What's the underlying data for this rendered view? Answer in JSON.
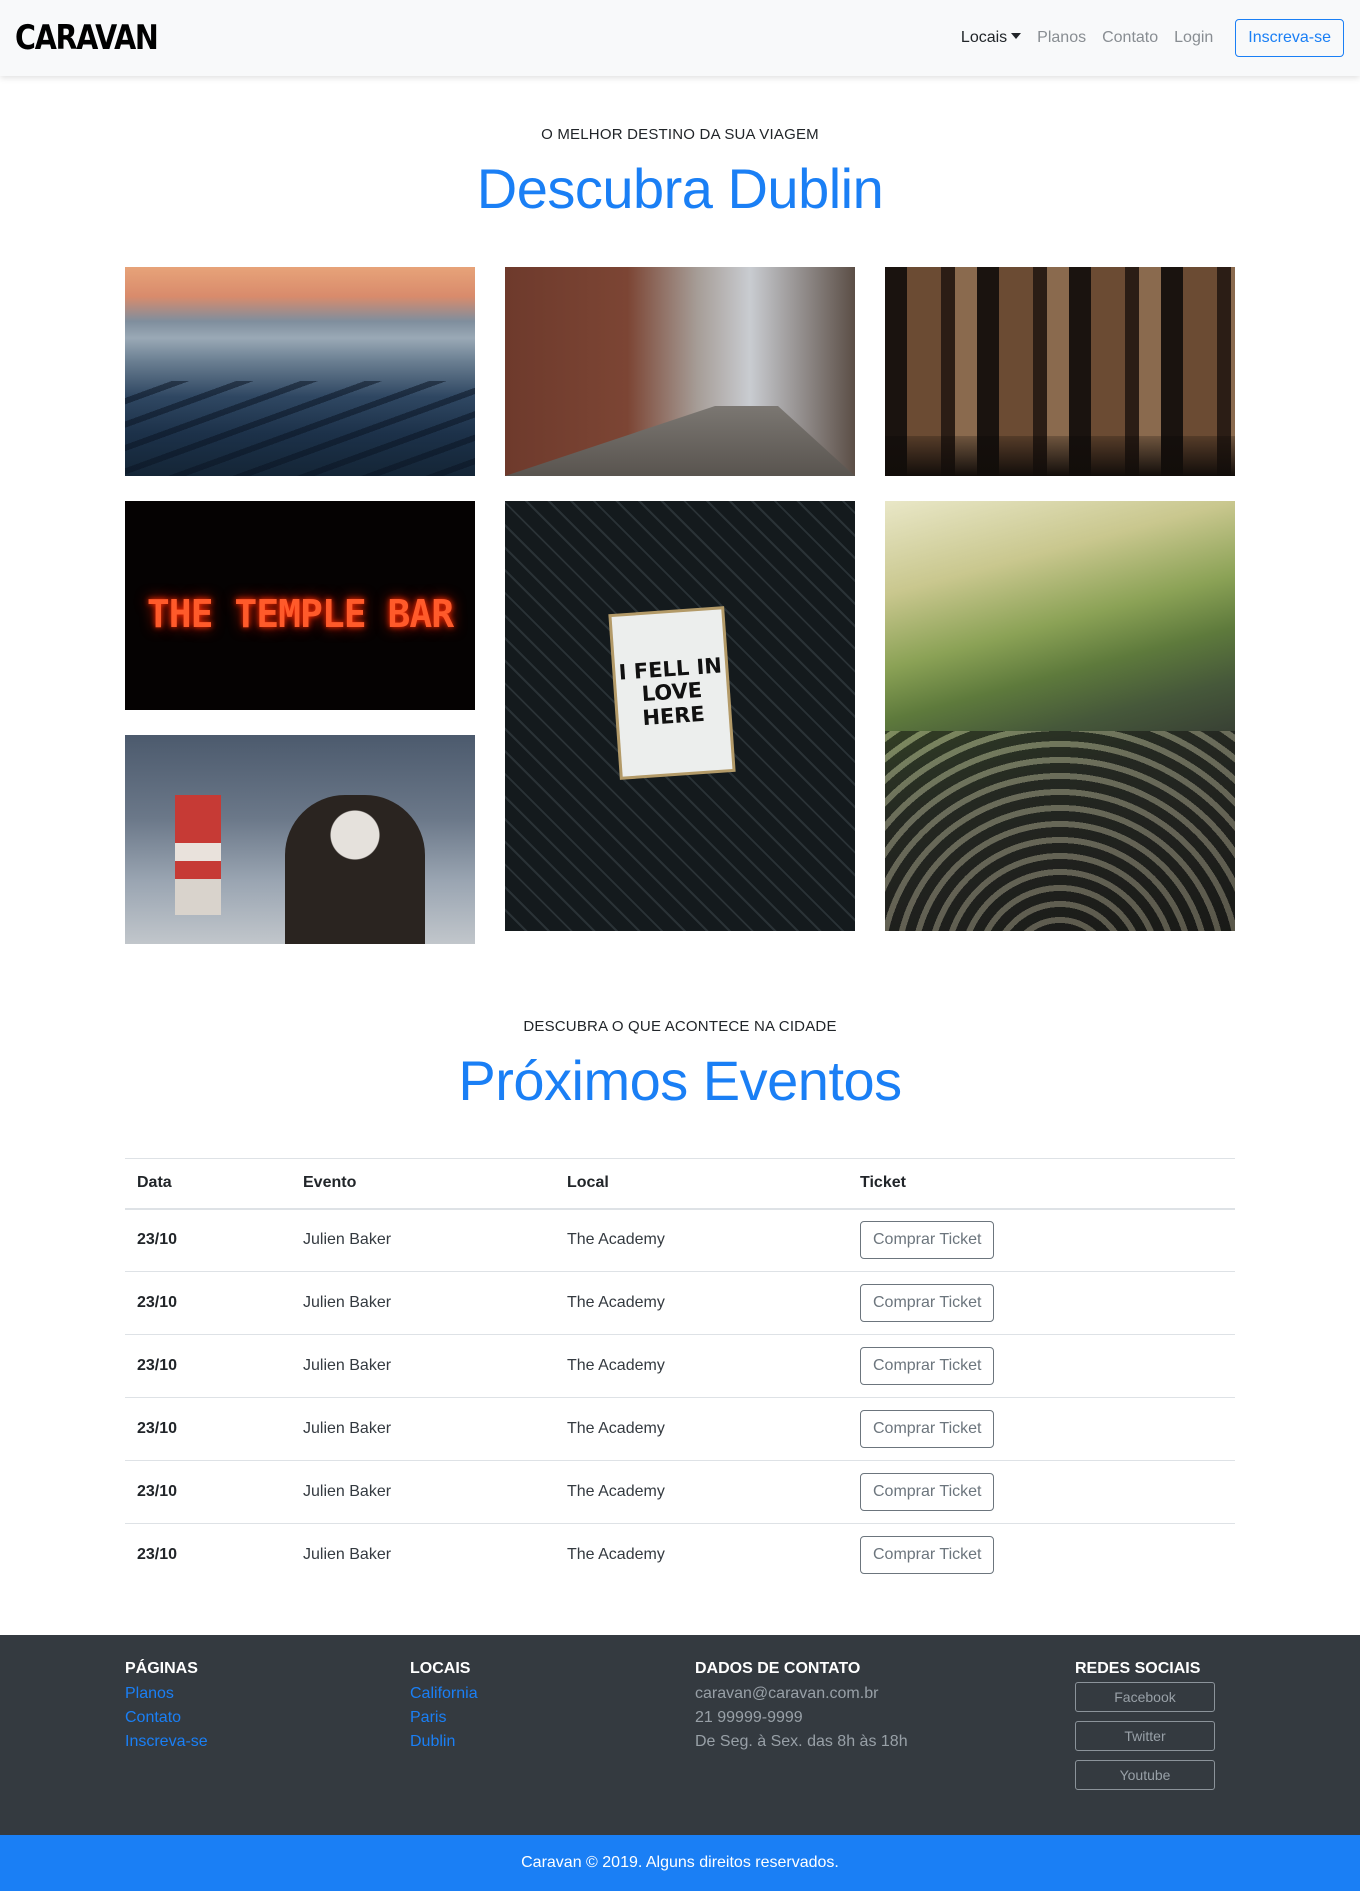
{
  "navbar": {
    "brand": "CARAVAN",
    "locais": "Locais",
    "planos": "Planos",
    "contato": "Contato",
    "login": "Login",
    "signup": "Inscreva-se"
  },
  "hero": {
    "kicker": "O MELHOR DESTINO DA SUA VIAGEM",
    "title": "Descubra Dublin"
  },
  "gallery": {
    "temple_sign": "THE TEMPLE BAR",
    "fell_sign": "I FELL IN LOVE HERE"
  },
  "events": {
    "kicker": "DESCUBRA O QUE ACONTECE NA CIDADE",
    "title": "Próximos Eventos",
    "headers": [
      "Data",
      "Evento",
      "Local",
      "Ticket"
    ],
    "rows": [
      {
        "date": "23/10",
        "event": "Julien Baker",
        "place": "The Academy",
        "ticket": "Comprar Ticket"
      },
      {
        "date": "23/10",
        "event": "Julien Baker",
        "place": "The Academy",
        "ticket": "Comprar Ticket"
      },
      {
        "date": "23/10",
        "event": "Julien Baker",
        "place": "The Academy",
        "ticket": "Comprar Ticket"
      },
      {
        "date": "23/10",
        "event": "Julien Baker",
        "place": "The Academy",
        "ticket": "Comprar Ticket"
      },
      {
        "date": "23/10",
        "event": "Julien Baker",
        "place": "The Academy",
        "ticket": "Comprar Ticket"
      },
      {
        "date": "23/10",
        "event": "Julien Baker",
        "place": "The Academy",
        "ticket": "Comprar Ticket"
      }
    ]
  },
  "footer": {
    "paginas": {
      "heading": "Páginas",
      "links": [
        "Planos",
        "Contato",
        "Inscreva-se"
      ]
    },
    "locais": {
      "heading": "Locais",
      "links": [
        "California",
        "Paris",
        "Dublin"
      ]
    },
    "contato": {
      "heading": "Dados de Contato",
      "lines": [
        "caravan@caravan.com.br",
        "21 99999-9999",
        "De Seg. à Sex. das 8h às 18h"
      ]
    },
    "social": {
      "heading": "Redes Sociais",
      "buttons": [
        "Facebook",
        "Twitter",
        "Youtube"
      ]
    },
    "copyright": "Caravan © 2019. Alguns direitos reservados."
  },
  "colors": {
    "accent": "#1a7ff5",
    "footer_bg": "#343a40",
    "navbar_bg": "#f8f9fa"
  }
}
